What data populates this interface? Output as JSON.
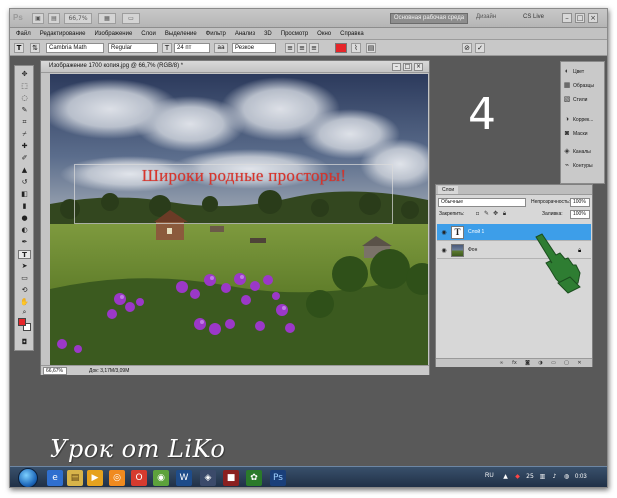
{
  "app": {
    "logo": "Ps",
    "zoom_label": "66,7%",
    "workspace_button": "Основная рабочая среда",
    "design_link": "Дизайн",
    "cs_live": "CS Live"
  },
  "menu": [
    "Файл",
    "Редактирование",
    "Изображение",
    "Слои",
    "Выделение",
    "Фильтр",
    "Анализ",
    "3D",
    "Просмотр",
    "Окно",
    "Справка"
  ],
  "options": {
    "font_family": "Cambria Math",
    "font_style": "Regular",
    "font_size": "24 пт",
    "antialias_label": "аа",
    "antialias": "Резкое",
    "text_color": "#e6262a"
  },
  "document": {
    "title": "Изображение 1700 копия.jpg @ 66,7% (RGB/8) *",
    "image_text": "Широки родные просторы!",
    "status_zoom": "66,67%",
    "status_size": "Док: 3,17M/3,09M"
  },
  "annotation": {
    "step_number": "4",
    "signature": "Урок от LiKo"
  },
  "dock": [
    "Цвет",
    "Образцы",
    "Стили",
    "Коррек...",
    "Маски",
    "Каналы",
    "Контуры"
  ],
  "layers_panel": {
    "tab": "Слои",
    "blend_mode": "Обычные",
    "opacity_label": "Непрозрачность:",
    "opacity": "100%",
    "lock_label": "Закрепить:",
    "fill_label": "Заливка:",
    "fill": "100%",
    "layers": [
      {
        "name": "Слой 1",
        "thumb": "T",
        "selected": true
      },
      {
        "name": "Фон",
        "thumb": "",
        "selected": false
      }
    ]
  },
  "taskbar": {
    "lang": "RU",
    "time": "0:03",
    "tray_number": "25"
  }
}
